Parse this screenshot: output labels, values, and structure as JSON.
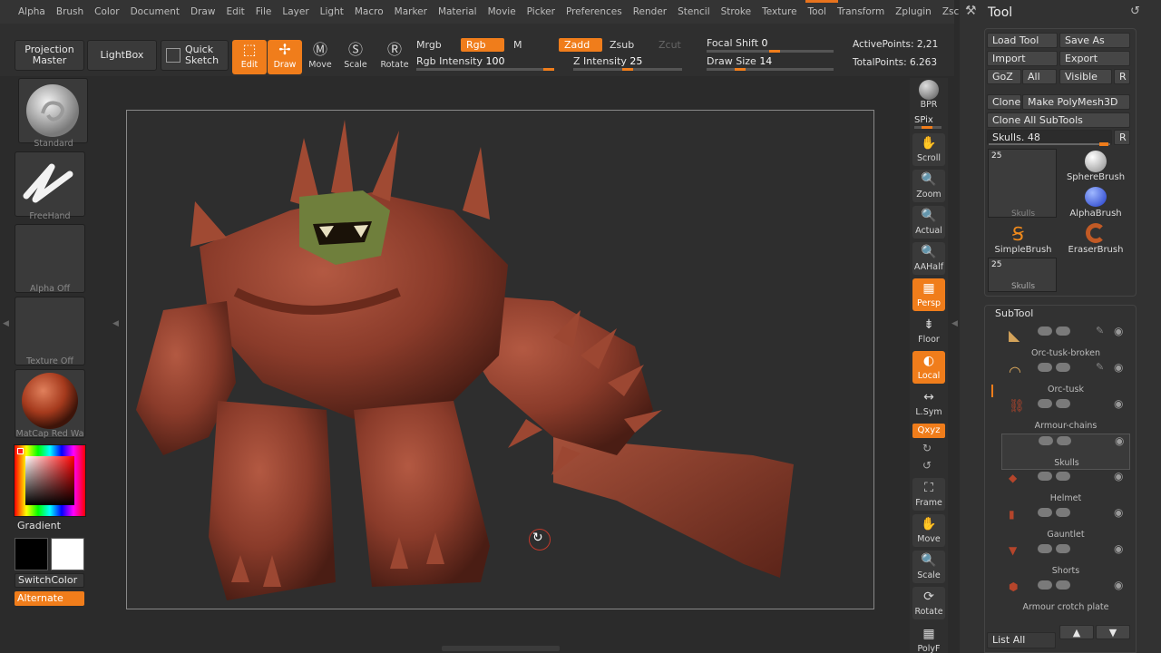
{
  "menu": [
    "Alpha",
    "Brush",
    "Color",
    "Document",
    "Draw",
    "Edit",
    "File",
    "Layer",
    "Light",
    "Macro",
    "Marker",
    "Material",
    "Movie",
    "Picker",
    "Preferences",
    "Render",
    "Stencil",
    "Stroke",
    "Texture",
    "Tool",
    "Transform",
    "Zplugin",
    "Zscript"
  ],
  "shelf": {
    "projection_master": "Projection Master",
    "lightbox": "LightBox",
    "quick_sketch": "Quick Sketch",
    "tools": [
      {
        "label": "Edit",
        "active": true
      },
      {
        "label": "Draw",
        "active": true
      },
      {
        "label": "Move",
        "active": false
      },
      {
        "label": "Scale",
        "active": false
      },
      {
        "label": "Rotate",
        "active": false
      }
    ],
    "mrgb": "Mrgb",
    "rgb": "Rgb",
    "m": "M",
    "zadd": "Zadd",
    "zsub": "Zsub",
    "zcut": "Zcut",
    "rgb_intensity_label": "Rgb Intensity",
    "rgb_intensity": "100",
    "z_intensity_label": "Z Intensity",
    "z_intensity": "25",
    "focal_shift_label": "Focal Shift",
    "focal_shift": "0",
    "draw_size_label": "Draw Size",
    "draw_size": "14",
    "active_points": "ActivePoints: 2,21",
    "total_points": "TotalPoints: 6.263"
  },
  "left": {
    "brush": "Standard",
    "stroke": "FreeHand",
    "alpha": "Alpha Off",
    "texture": "Texture Off",
    "material": "MatCap Red Wa",
    "gradient": "Gradient",
    "switch_color": "SwitchColor",
    "alternate": "Alternate"
  },
  "nav": [
    {
      "label": "BPR",
      "active": false
    },
    {
      "label": "SPix",
      "active": false
    },
    {
      "label": "Scroll",
      "active": false
    },
    {
      "label": "Zoom",
      "active": false
    },
    {
      "label": "Actual",
      "active": false
    },
    {
      "label": "AAHalf",
      "active": false
    },
    {
      "label": "Persp",
      "active": true
    },
    {
      "label": "Floor",
      "active": false
    },
    {
      "label": "Local",
      "active": true
    },
    {
      "label": "L.Sym",
      "active": false
    },
    {
      "label": "Qxyz",
      "active": true
    },
    {
      "label": "Frame",
      "active": false
    },
    {
      "label": "Move",
      "active": false
    },
    {
      "label": "Scale",
      "active": false
    },
    {
      "label": "Rotate",
      "active": false
    },
    {
      "label": "PolyF",
      "active": false
    }
  ],
  "tool_panel": {
    "title": "Tool",
    "load_tool": "Load Tool",
    "save_as": "Save As",
    "import": "Import",
    "export": "Export",
    "goz": "GoZ",
    "all": "All",
    "visible": "Visible",
    "r": "R",
    "clone": "Clone",
    "make_polymesh": "Make PolyMesh3D",
    "clone_all": "Clone All SubTools",
    "skulls_slider": "Skulls. 48",
    "thumbs": [
      {
        "label": "Skulls",
        "count": "25"
      },
      {
        "label": "SphereBrush"
      },
      {
        "label": "AlphaBrush"
      },
      {
        "label": "SimpleBrush"
      },
      {
        "label": "EraserBrush"
      },
      {
        "label": "Skulls",
        "count": "25"
      }
    ]
  },
  "subtool": {
    "title": "SubTool",
    "items": [
      "Orc-tusk-broken",
      "Orc-tusk",
      "Armour-chains",
      "Skulls",
      "Helmet",
      "Gauntlet",
      "Shorts",
      "Armour crotch plate"
    ],
    "list_all": "List All"
  },
  "colors": {
    "accent": "#f07d1b",
    "model": "#8a3b2a"
  }
}
